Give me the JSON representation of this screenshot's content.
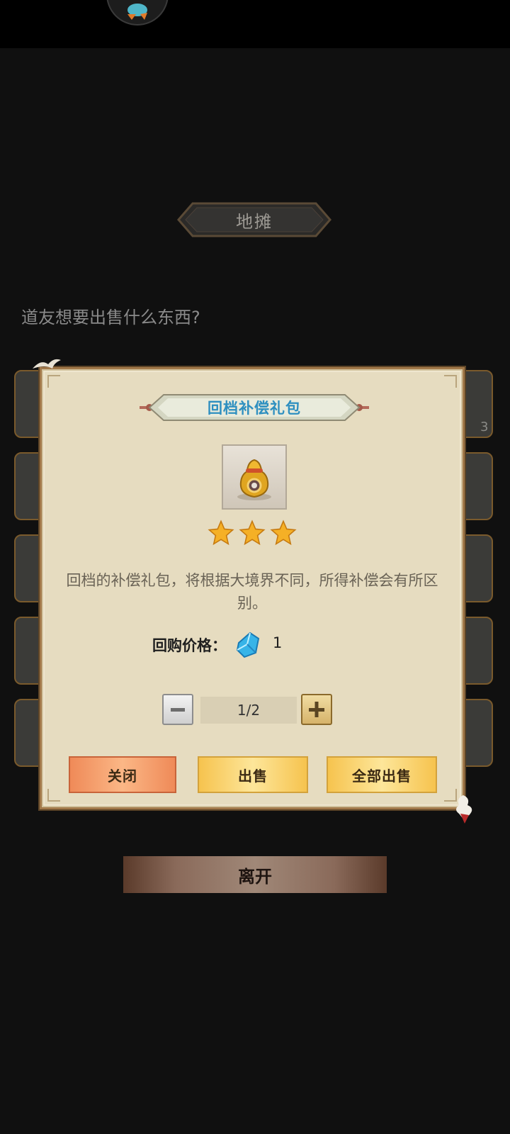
{
  "header": {
    "title": "地摊"
  },
  "prompt": "道友想要出售什么东西?",
  "background_slots": {
    "visible_count": "3"
  },
  "dialog": {
    "item_name": "回档补偿礼包",
    "item_icon": "gold-money-bag-icon",
    "star_rating": 3,
    "description": "回档的补偿礼包，将根据大境界不同，所得补偿会有所区别。",
    "price_label": "回购价格：",
    "price_currency_icon": "blue-crystal-icon",
    "price_value": "1",
    "quantity": "1/2",
    "buttons": {
      "close": "关闭",
      "sell": "出售",
      "sell_all": "全部出售"
    }
  },
  "footer": {
    "leave_label": "离开"
  },
  "colors": {
    "dialog_bg": "#e6dcc0",
    "item_title": "#2e8fc0",
    "close_btn": "#ef8a58",
    "sell_btn": "#f6c34e"
  }
}
